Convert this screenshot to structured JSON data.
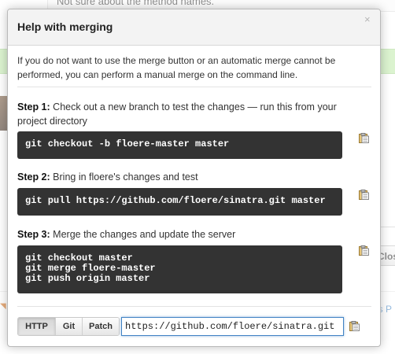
{
  "background": {
    "top_text": "Not sure about the method names.",
    "close_button_label": "Close",
    "link_fragment": "is P"
  },
  "modal": {
    "title": "Help with merging",
    "close_glyph": "×",
    "intro": "If you do not want to use the merge button or an automatic merge cannot be performed, you can perform a manual merge on the command line.",
    "steps": [
      {
        "label": "Step 1:",
        "text": " Check out a new branch to test the changes — run this from your project directory",
        "code": "git checkout -b floere-master master"
      },
      {
        "label": "Step 2:",
        "text": " Bring in floere's changes and test",
        "code": "git pull https://github.com/floere/sinatra.git master"
      },
      {
        "label": "Step 3:",
        "text": " Merge the changes and update the server",
        "code": "git checkout master\ngit merge floere-master\ngit push origin master"
      }
    ],
    "clone": {
      "protocols": [
        "HTTP",
        "Git",
        "Patch"
      ],
      "selected": "HTTP",
      "url": "https://github.com/floere/sinatra.git"
    }
  },
  "colors": {
    "code_bg": "#333333",
    "accent": "#4183c4",
    "green_bar": "#bdeaa8"
  },
  "icons": {
    "copy": "clipboard-icon",
    "close": "close-icon"
  }
}
